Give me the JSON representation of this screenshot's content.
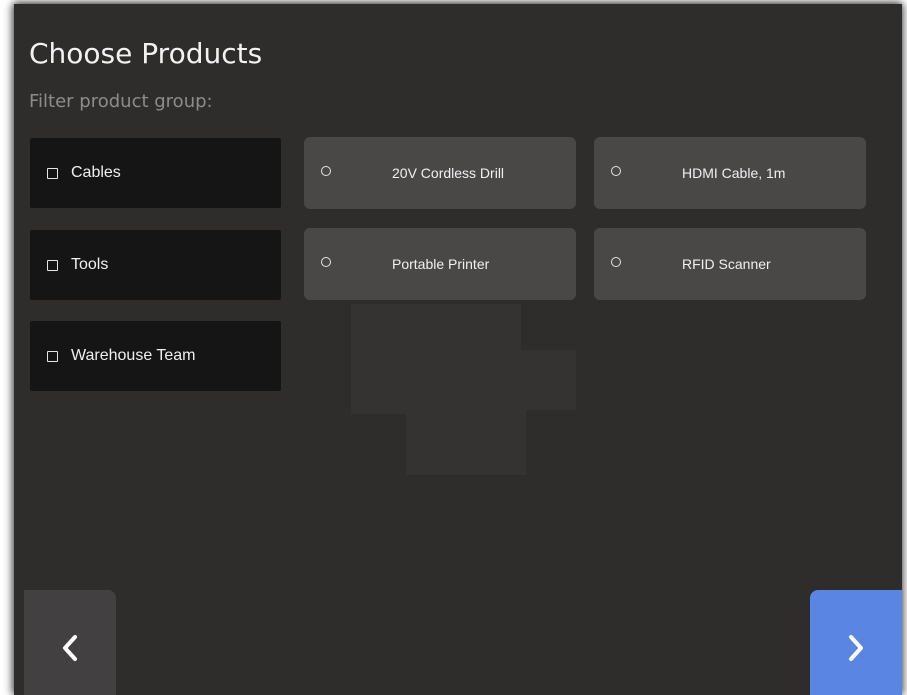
{
  "page": {
    "title": "Choose Products",
    "subtitle": "Filter product group:"
  },
  "filters": [
    {
      "label": "Cables",
      "checked": false
    },
    {
      "label": "Tools",
      "checked": false
    },
    {
      "label": "Warehouse Team",
      "checked": false
    }
  ],
  "products": [
    {
      "label": "20V Cordless Drill",
      "selected": false
    },
    {
      "label": "HDMI Cable, 1m",
      "selected": false
    },
    {
      "label": "Portable Printer",
      "selected": false
    },
    {
      "label": "RFID Scanner",
      "selected": false
    }
  ],
  "navigation": {
    "back_icon": "chevron-left-icon",
    "next_icon": "chevron-right-icon"
  },
  "colors": {
    "background": "#2f2c2c",
    "filter_bg": "#161515",
    "product_bg": "#4a4747",
    "next_button": "#5b85e2",
    "back_button": "#424040"
  }
}
